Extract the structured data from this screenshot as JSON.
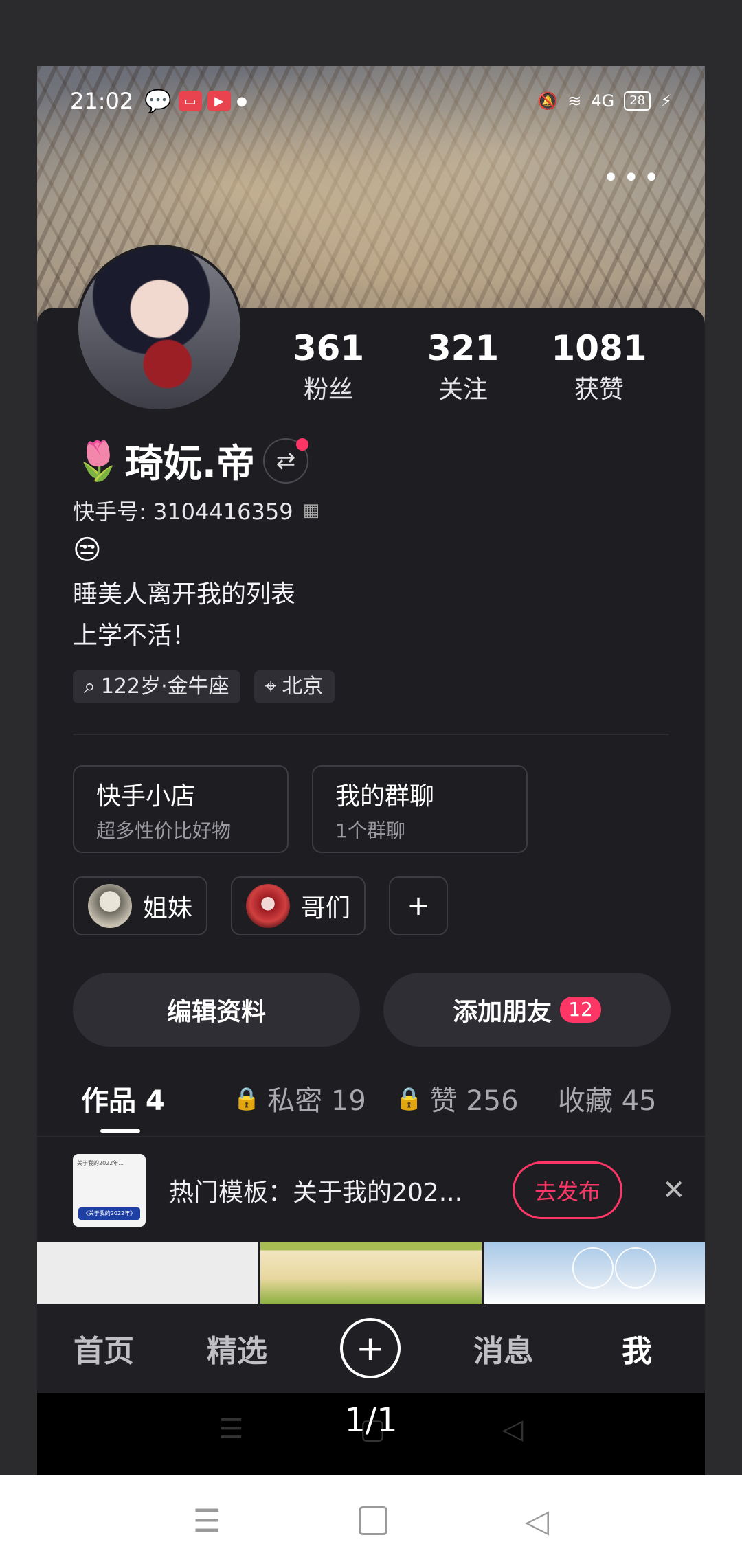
{
  "status_bar": {
    "time": "21:02",
    "battery": "28",
    "network": "4G"
  },
  "profile": {
    "name": "琦妧.帝",
    "kuaishou_id": "快手号: 3104416359",
    "emoji": "😒",
    "bio_lines": [
      "睡美人离开我的列表",
      "上学不活！"
    ],
    "tags": [
      "122岁·金牛座",
      "北京"
    ]
  },
  "stats": [
    {
      "value": "361",
      "label": "粉丝"
    },
    {
      "value": "321",
      "label": "关注"
    },
    {
      "value": "1081",
      "label": "获赞"
    }
  ],
  "entries": [
    {
      "title": "快手小店",
      "subtitle": "超多性价比好物"
    },
    {
      "title": "我的群聊",
      "subtitle": "1个群聊"
    }
  ],
  "groups": [
    "姐妹",
    "哥们"
  ],
  "buttons": {
    "edit": "编辑资料",
    "add_friend": "添加朋友",
    "add_friend_badge": "12"
  },
  "tabs": [
    {
      "label": "作品 4"
    },
    {
      "label": "私密 19"
    },
    {
      "label": "赞 256"
    },
    {
      "label": "收藏 45"
    }
  ],
  "promo": {
    "text": "热门模板：关于我的202...",
    "button": "去发布",
    "thumb_top": "关于我的2022年...",
    "thumb_bottom": "《关于我的2022年》"
  },
  "bottom_nav": {
    "home": "首页",
    "featured": "精选",
    "messages": "消息",
    "me": "我"
  },
  "pager": "1/1",
  "colors": {
    "accent": "#fe3666",
    "background": "#1e1e22"
  }
}
